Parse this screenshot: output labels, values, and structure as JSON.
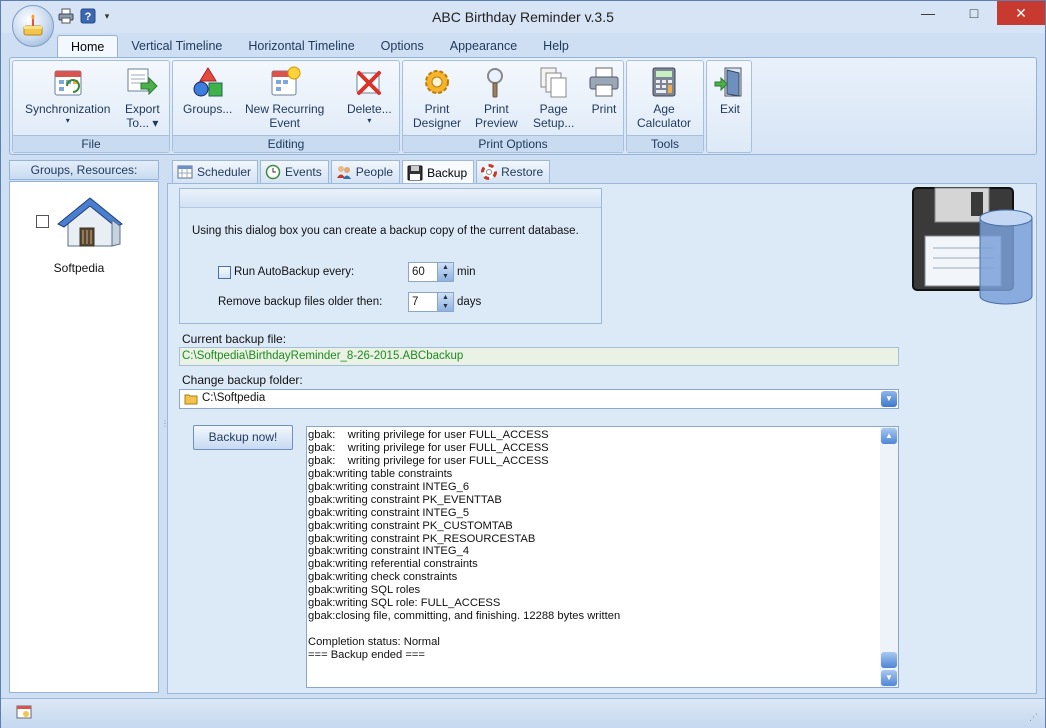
{
  "window": {
    "title": "ABC Birthday Reminder v.3.5"
  },
  "window_controls": {
    "minimize": "—",
    "maximize": "□",
    "close": "✕"
  },
  "quick_access": {
    "dropdown": "▾"
  },
  "ribbon": {
    "tabs": [
      {
        "label": "Home",
        "active": true
      },
      {
        "label": "Vertical Timeline"
      },
      {
        "label": "Horizontal Timeline"
      },
      {
        "label": "Options"
      },
      {
        "label": "Appearance"
      },
      {
        "label": "Help"
      }
    ],
    "groups": {
      "file": {
        "label": "File",
        "sync_line1": "Synchronization",
        "sync_dd": "▾",
        "export_line1": "Export",
        "export_line2": "To... ▾"
      },
      "editing": {
        "label": "Editing",
        "groups_line1": "Groups...",
        "recurring_line1": "New Recurring",
        "recurring_line2": "Event",
        "delete_line1": "Delete...",
        "delete_dd": "▾"
      },
      "print_options": {
        "label": "Print Options",
        "designer_line1": "Print",
        "designer_line2": "Designer",
        "preview_line1": "Print",
        "preview_line2": "Preview",
        "setup_line1": "Page",
        "setup_line2": "Setup...",
        "print_line1": "Print"
      },
      "tools": {
        "label": "Tools",
        "age_line1": "Age",
        "age_line2": "Calculator"
      },
      "exit": {
        "label": "Exit"
      }
    }
  },
  "left_pane": {
    "header": "Groups, Resources:",
    "resource": {
      "label": "Softpedia"
    },
    "splitter": "⋮"
  },
  "content_tabs": [
    {
      "label": "Scheduler"
    },
    {
      "label": "Events"
    },
    {
      "label": "People"
    },
    {
      "label": "Backup",
      "active": true
    },
    {
      "label": "Restore"
    }
  ],
  "backup": {
    "info": "Using this dialog box you can create a backup copy of the current database.",
    "auto_backup_label": "Run AutoBackup every:",
    "auto_backup_value": "60",
    "auto_backup_unit": "min",
    "remove_label": "Remove backup files older then:",
    "remove_value": "7",
    "remove_unit": "days",
    "current_file_label": "Current backup file:",
    "current_file": "C:\\Softpedia\\BirthdayReminder_8-26-2015.ABCbackup",
    "change_folder_label": "Change backup folder:",
    "folder": "C:\\Softpedia",
    "backup_button": "Backup now!"
  },
  "log": [
    "gbak:    writing privilege for user FULL_ACCESS",
    "gbak:    writing privilege for user FULL_ACCESS",
    "gbak:    writing privilege for user FULL_ACCESS",
    "gbak:writing table constraints",
    "gbak:writing constraint INTEG_6",
    "gbak:writing constraint PK_EVENTTAB",
    "gbak:writing constraint INTEG_5",
    "gbak:writing constraint PK_CUSTOMTAB",
    "gbak:writing constraint PK_RESOURCESTAB",
    "gbak:writing constraint INTEG_4",
    "gbak:writing referential constraints",
    "gbak:writing check constraints",
    "gbak:writing SQL roles",
    "gbak:writing SQL role: FULL_ACCESS",
    "gbak:closing file, committing, and finishing. 12288 bytes written",
    "",
    "Completion status: Normal",
    "=== Backup ended ==="
  ],
  "colors": {
    "accent": "#3f78cc",
    "path_text": "#1f8a1f",
    "close_button": "#c83a2f"
  }
}
